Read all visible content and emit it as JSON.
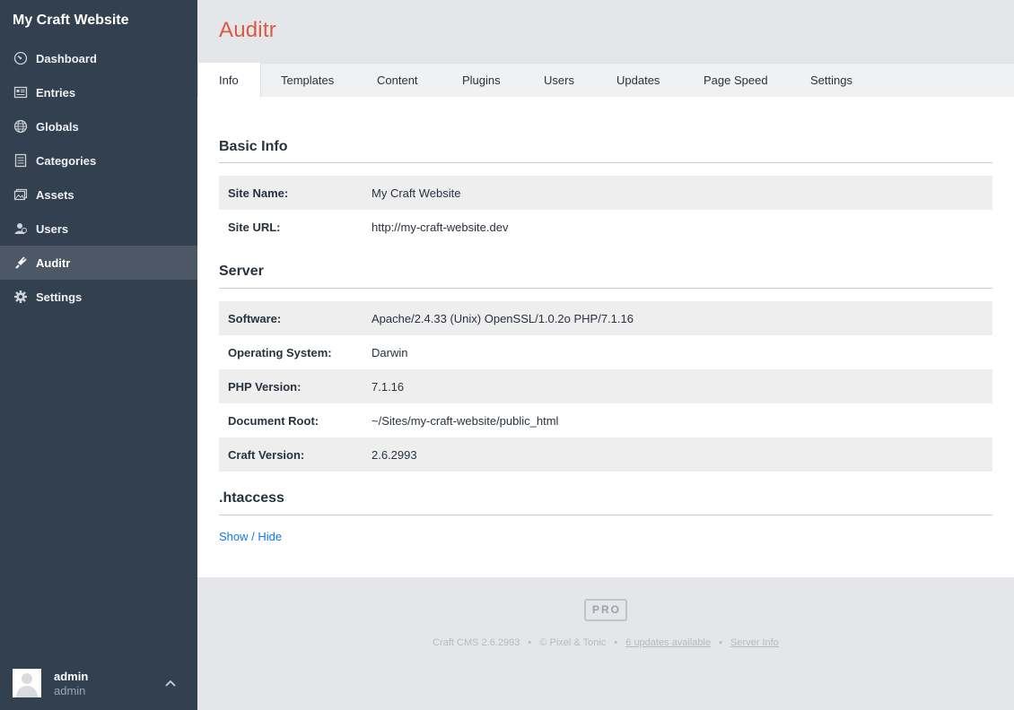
{
  "sidebar": {
    "site_name": "My Craft Website",
    "items": [
      {
        "label": "Dashboard",
        "icon": "dashboard-gauge-icon"
      },
      {
        "label": "Entries",
        "icon": "entries-icon"
      },
      {
        "label": "Globals",
        "icon": "globe-icon"
      },
      {
        "label": "Categories",
        "icon": "categories-icon"
      },
      {
        "label": "Assets",
        "icon": "assets-images-icon"
      },
      {
        "label": "Users",
        "icon": "users-icon"
      },
      {
        "label": "Auditr",
        "icon": "plug-icon",
        "active": true
      },
      {
        "label": "Settings",
        "icon": "gear-icon"
      }
    ],
    "user": {
      "name": "admin",
      "role": "admin"
    }
  },
  "header": {
    "title": "Auditr"
  },
  "tabs": [
    {
      "label": "Info",
      "active": true
    },
    {
      "label": "Templates"
    },
    {
      "label": "Content"
    },
    {
      "label": "Plugins"
    },
    {
      "label": "Users"
    },
    {
      "label": "Updates"
    },
    {
      "label": "Page Speed"
    },
    {
      "label": "Settings"
    }
  ],
  "basic_info": {
    "title": "Basic Info",
    "rows": [
      {
        "label": "Site Name:",
        "value": "My Craft Website"
      },
      {
        "label": "Site URL:",
        "value": "http://my-craft-website.dev"
      }
    ]
  },
  "server": {
    "title": "Server",
    "rows": [
      {
        "label": "Software:",
        "value": "Apache/2.4.33 (Unix) OpenSSL/1.0.2o PHP/7.1.16"
      },
      {
        "label": "Operating System:",
        "value": "Darwin"
      },
      {
        "label": "PHP Version:",
        "value": "7.1.16"
      },
      {
        "label": "Document Root:",
        "value": "~/Sites/my-craft-website/public_html"
      },
      {
        "label": "Craft Version:",
        "value": "2.6.2993"
      }
    ]
  },
  "htaccess": {
    "title": ".htaccess",
    "toggle_label": "Show / Hide"
  },
  "footer": {
    "badge": "PRO",
    "cms_version": "Craft CMS 2.6.2993",
    "copyright": "© Pixel & Tonic",
    "updates_link": "6 updates available",
    "server_info_link": "Server Info",
    "separator": "•"
  },
  "colors": {
    "sidebar_bg": "#33404f",
    "sidebar_active": "#4d5867",
    "title_accent": "#da5a47",
    "link": "#0d78f2"
  }
}
